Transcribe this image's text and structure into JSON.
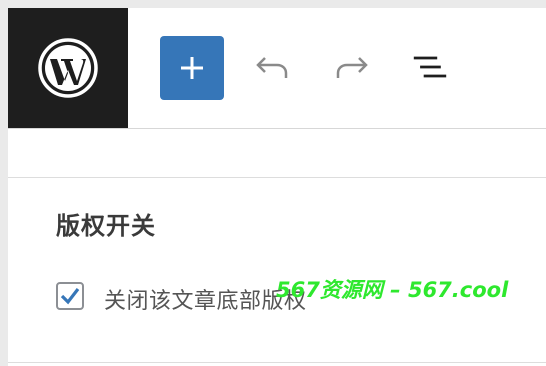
{
  "toolbar": {
    "logo_icon": "wordpress-logo-icon",
    "add_icon": "plus-icon",
    "undo_icon": "undo-icon",
    "redo_icon": "redo-icon",
    "outline_icon": "list-view-icon",
    "add_button_color": "#3676b8",
    "logo_background": "#1e1e1e"
  },
  "section": {
    "title": "版权开关"
  },
  "option": {
    "checked": true,
    "label": "关闭该文章底部版权",
    "check_color": "#3676b8"
  },
  "watermark": {
    "text": "567资源网 – 567.cool",
    "color": "#2ee82e"
  }
}
